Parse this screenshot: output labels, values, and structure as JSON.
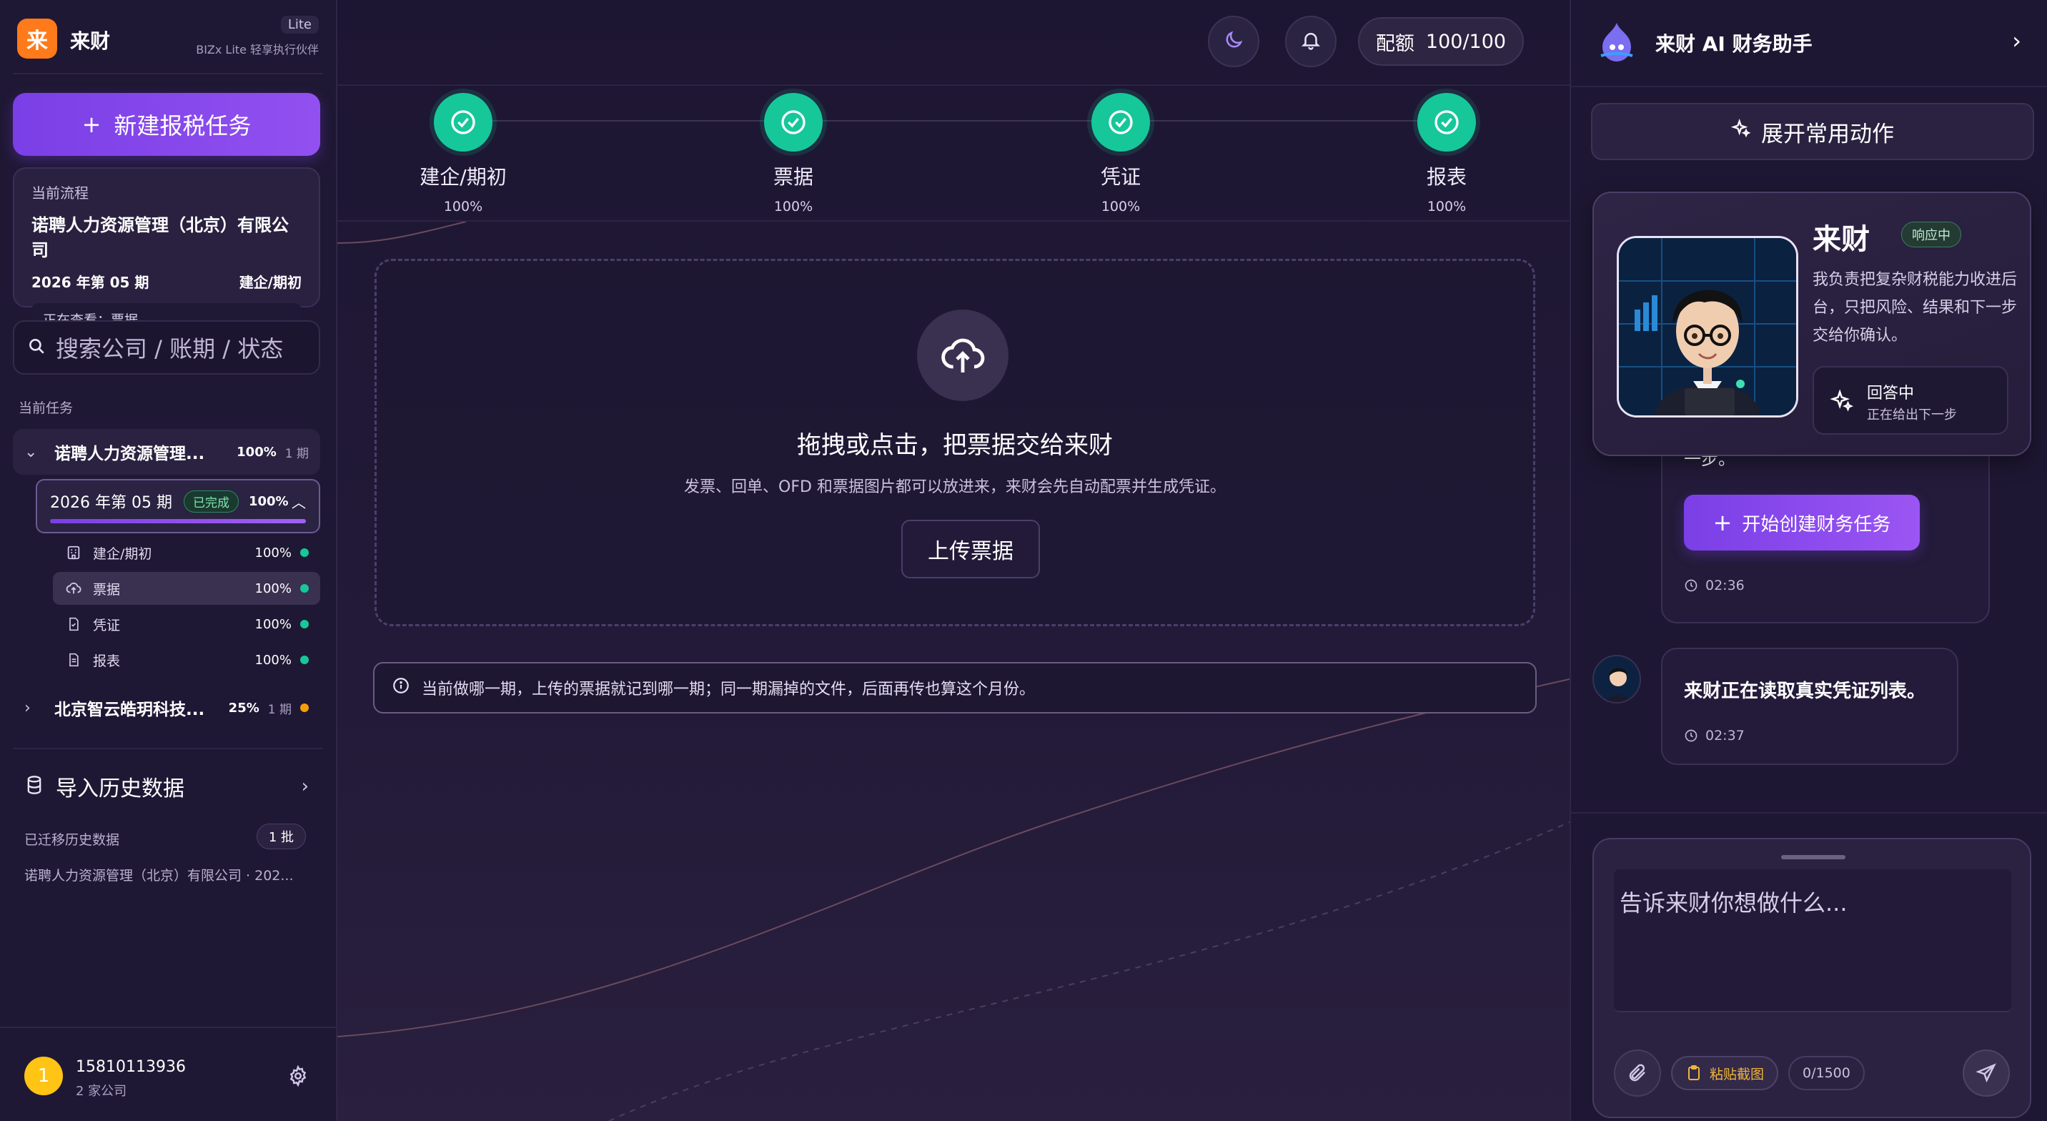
{
  "brand": {
    "logo": "来",
    "name": "来财",
    "badge": "Lite",
    "tagline": "BIZx Lite 轻享执行伙伴"
  },
  "sidebar": {
    "new_task": "新建报税任务",
    "current_flow": {
      "label": "当前流程",
      "company": "诺聘人力资源管理（北京）有限公司",
      "period": "2026 年第 05 期",
      "stage": "建企/期初",
      "viewing": "正在查看：票据"
    },
    "search_placeholder": "搜索公司 / 账期 / 状态",
    "section_label": "当前任务",
    "tasks": [
      {
        "name": "诺聘人力资源管理...",
        "pct": "100%",
        "periods": "1 期"
      },
      {
        "name": "北京智云皓玥科技...",
        "pct": "25%",
        "periods": "1 期",
        "dot_color": "#f59e0b"
      }
    ],
    "period": {
      "title": "2026 年第 05 期",
      "status": "已完成",
      "pct": "100%",
      "progress": 1.0
    },
    "steps": [
      {
        "icon": "building-icon",
        "name": "建企/期初",
        "pct": "100%"
      },
      {
        "icon": "cloud-upload-icon",
        "name": "票据",
        "pct": "100%"
      },
      {
        "icon": "voucher-icon",
        "name": "凭证",
        "pct": "100%"
      },
      {
        "icon": "report-icon",
        "name": "报表",
        "pct": "100%"
      }
    ],
    "import": {
      "label": "导入历史数据",
      "migrated_label": "已迁移历史数据",
      "batch": "1 批",
      "item": "诺聘人力资源管理（北京）有限公司 · 202..."
    },
    "user": {
      "avatar": "1",
      "phone": "15810113936",
      "companies": "2 家公司"
    }
  },
  "topbar": {
    "quota_label": "配额",
    "quota_value": "100/100"
  },
  "progress_steps": [
    {
      "label": "建企/期初",
      "value": "100%"
    },
    {
      "label": "票据",
      "value": "100%"
    },
    {
      "label": "凭证",
      "value": "100%"
    },
    {
      "label": "报表",
      "value": "100%"
    }
  ],
  "upload": {
    "title": "拖拽或点击，把票据交给来财",
    "desc": "发票、回单、OFD 和票据图片都可以放进来，来财会先自动配票并生成凭证。",
    "button": "上传票据",
    "notice": "当前做哪一期，上传的票据就记到哪一期；同一期漏掉的文件，后面再传也算这个月份。"
  },
  "assistant": {
    "title": "来财 AI 财务助手",
    "expand": "展开常用动作",
    "agent": {
      "name": "来财",
      "status": "响应中",
      "desc": "我负责把复杂财税能力收进后台，只把风险、结果和下一步交给你确认。",
      "state_title": "回答中",
      "state_sub": "正在给出下一步"
    },
    "messages": [
      {
        "text": "一步。",
        "button": "开始创建财务任务",
        "time": "02:36"
      },
      {
        "text": "来财正在读取真实凭证列表。",
        "time": "02:37"
      }
    ],
    "composer": {
      "placeholder": "告诉来财你想做什么...",
      "paste": "粘贴截图",
      "count": "0/1500"
    }
  },
  "colors": {
    "accent": "#7a3fe6",
    "success": "#16c79a",
    "brand_orange": "#ff7a1a",
    "warning": "#f59e0b"
  }
}
